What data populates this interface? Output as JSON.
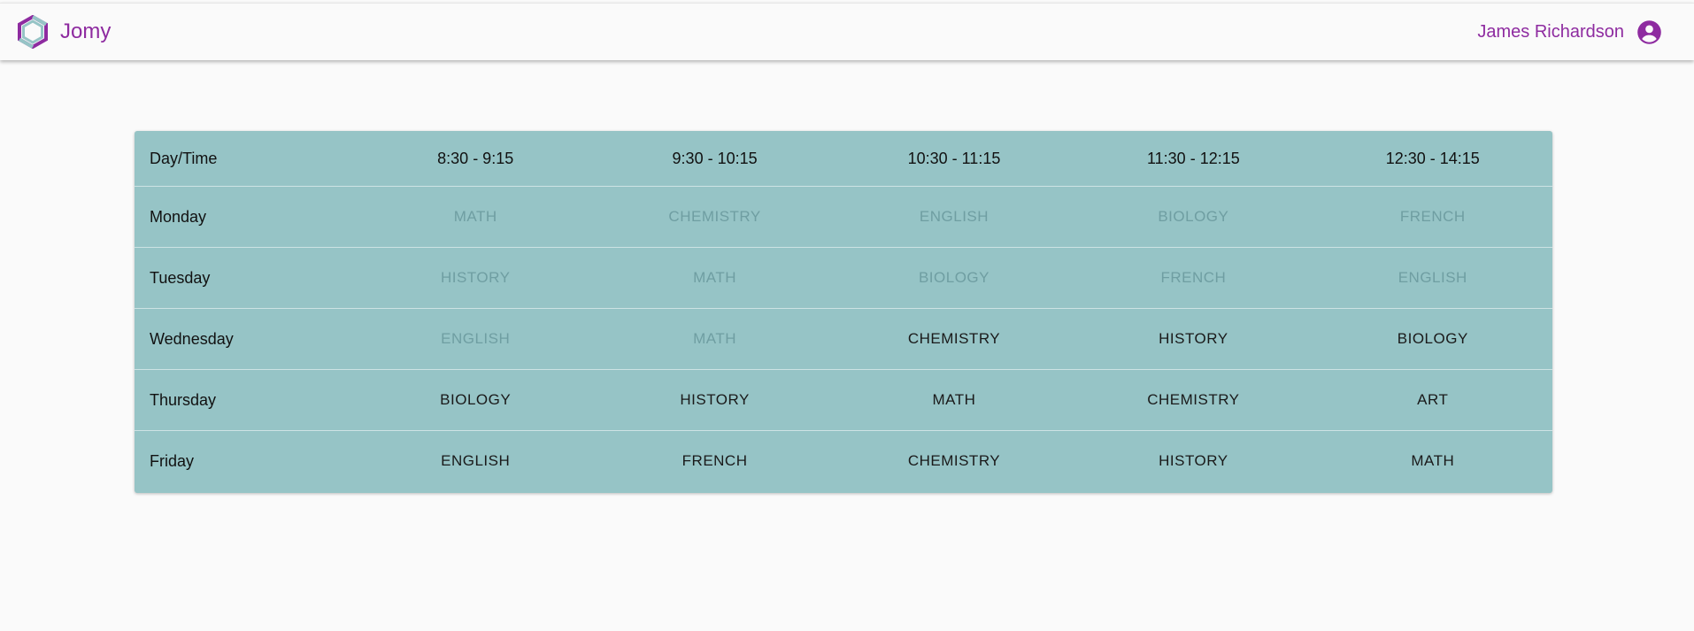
{
  "app": {
    "name": "Jomy",
    "user_name": "James Richardson"
  },
  "colors": {
    "brand": "#8e2ba0",
    "table_bg": "#96c4c6",
    "past_text": "#6f9ea2"
  },
  "icons": {
    "logo": "jomy-logo-icon",
    "user": "account-circle-icon"
  },
  "timetable": {
    "header": [
      "Day/Time",
      "8:30 - 9:15",
      "9:30 - 10:15",
      "10:30 - 11:15",
      "11:30 - 12:15",
      "12:30 - 14:15"
    ],
    "rows": [
      {
        "day": "Monday",
        "cells": [
          {
            "subject": "MATH",
            "past": true
          },
          {
            "subject": "CHEMISTRY",
            "past": true
          },
          {
            "subject": "ENGLISH",
            "past": true
          },
          {
            "subject": "BIOLOGY",
            "past": true
          },
          {
            "subject": "FRENCH",
            "past": true
          }
        ]
      },
      {
        "day": "Tuesday",
        "cells": [
          {
            "subject": "HISTORY",
            "past": true
          },
          {
            "subject": "MATH",
            "past": true
          },
          {
            "subject": "BIOLOGY",
            "past": true
          },
          {
            "subject": "FRENCH",
            "past": true
          },
          {
            "subject": "ENGLISH",
            "past": true
          }
        ]
      },
      {
        "day": "Wednesday",
        "cells": [
          {
            "subject": "ENGLISH",
            "past": true
          },
          {
            "subject": "MATH",
            "past": true
          },
          {
            "subject": "CHEMISTRY",
            "past": false
          },
          {
            "subject": "HISTORY",
            "past": false
          },
          {
            "subject": "BIOLOGY",
            "past": false
          }
        ]
      },
      {
        "day": "Thursday",
        "cells": [
          {
            "subject": "BIOLOGY",
            "past": false
          },
          {
            "subject": "HISTORY",
            "past": false
          },
          {
            "subject": "MATH",
            "past": false
          },
          {
            "subject": "CHEMISTRY",
            "past": false
          },
          {
            "subject": "ART",
            "past": false
          }
        ]
      },
      {
        "day": "Friday",
        "cells": [
          {
            "subject": "ENGLISH",
            "past": false
          },
          {
            "subject": "FRENCH",
            "past": false
          },
          {
            "subject": "CHEMISTRY",
            "past": false
          },
          {
            "subject": "HISTORY",
            "past": false
          },
          {
            "subject": "MATH",
            "past": false
          }
        ]
      }
    ]
  }
}
